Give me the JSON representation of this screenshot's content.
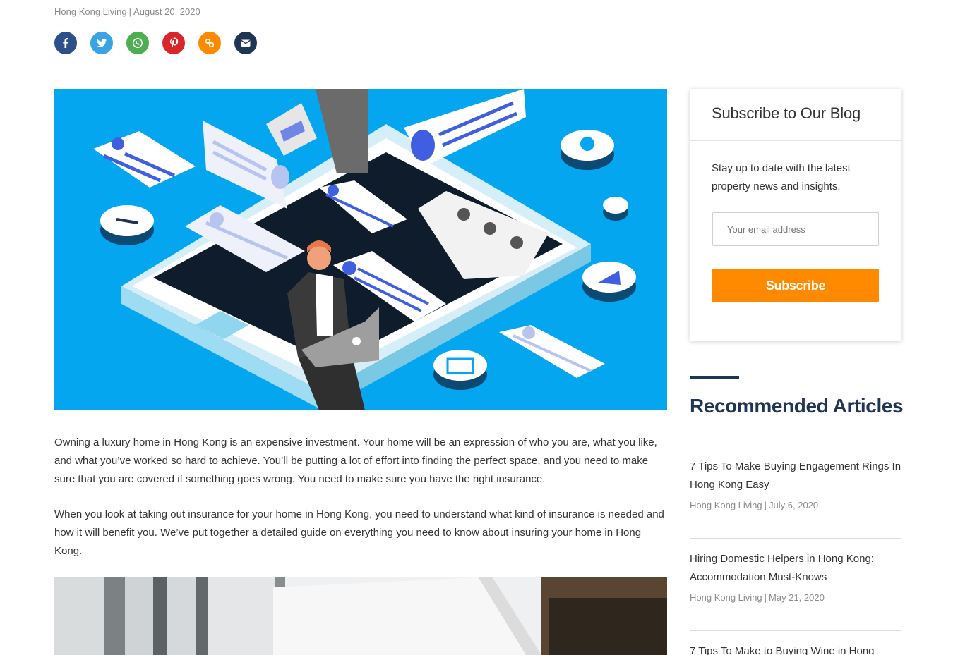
{
  "post_meta": {
    "category": "Hong Kong Living",
    "separator": "|",
    "date": "August 20, 2020"
  },
  "share_buttons": [
    {
      "name": "facebook",
      "color": "#2d4f8a"
    },
    {
      "name": "twitter",
      "color": "#3aa3e3"
    },
    {
      "name": "whatsapp",
      "color": "#4caf50"
    },
    {
      "name": "pinterest",
      "color": "#d9262a"
    },
    {
      "name": "copy-link",
      "color": "#ff8a00"
    },
    {
      "name": "email",
      "color": "#1f3556"
    }
  ],
  "article": {
    "paragraphs": [
      "Owning a luxury home in Hong Kong is an expensive investment. Your home will be an expression of who you are, what you like, and what you’ve worked so hard to achieve. You’ll be putting a lot of effort into finding the perfect space, and you need to make sure that you are covered if something goes wrong. You need to make sure you have the right insurance.",
      "When you look at taking out insurance for your home in Hong Kong, you need to understand what kind of insurance is needed and how it will benefit you. We’ve put together a detailed guide on everything you need to know about insuring your home in Hong Kong."
    ]
  },
  "subscribe": {
    "title": "Subscribe to Our Blog",
    "description": "Stay up to date with the latest property news and insights.",
    "email_placeholder": "Your email address",
    "button_label": "Subscribe",
    "button_color": "#ff8a00"
  },
  "recommended": {
    "title": "Recommended Articles",
    "accent_color": "#1f3556",
    "items": [
      {
        "title": "7 Tips To Make Buying Engagement Rings In Hong Kong Easy",
        "category": "Hong Kong Living",
        "separator": "|",
        "date": "July 6, 2020"
      },
      {
        "title": "Hiring Domestic Helpers in Hong Kong: Accommodation Must-Knows",
        "category": "Hong Kong Living",
        "separator": "|",
        "date": "May 21, 2020"
      },
      {
        "title": "7 Tips To Make to Buying Wine in Hong"
      }
    ]
  }
}
